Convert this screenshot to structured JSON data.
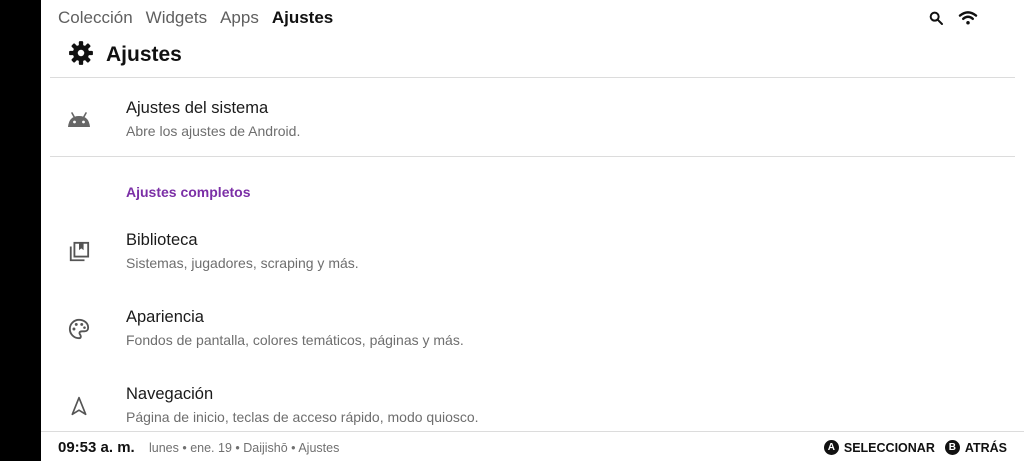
{
  "nav": {
    "tabs": [
      {
        "label": "Colección"
      },
      {
        "label": "Widgets"
      },
      {
        "label": "Apps"
      },
      {
        "label": "Ajustes"
      }
    ],
    "active_tab": "Ajustes",
    "icons": [
      "search-icon",
      "wifi-icon"
    ]
  },
  "page": {
    "icon": "gear-icon",
    "title": "Ajustes"
  },
  "system_item": {
    "icon": "android-icon",
    "title": "Ajustes del sistema",
    "subtitle": "Abre los ajustes de Android."
  },
  "section_label": "Ajustes completos",
  "items": [
    {
      "icon": "library-icon",
      "title": "Biblioteca",
      "subtitle": "Sistemas, jugadores, scraping y más."
    },
    {
      "icon": "palette-icon",
      "title": "Apariencia",
      "subtitle": "Fondos de pantalla, colores temáticos, páginas y más."
    },
    {
      "icon": "navigation-icon",
      "title": "Navegación",
      "subtitle": "Página de inicio, teclas de acceso rápido, modo quiosco."
    }
  ],
  "footer": {
    "time": "09:53 a. m.",
    "info": "lunes • ene. 19 • Daijishō • Ajustes",
    "hints": [
      {
        "button": "A",
        "label": "SELECCIONAR"
      },
      {
        "button": "B",
        "label": "ATRÁS"
      }
    ]
  },
  "colors": {
    "accent": "#7b2fa6",
    "text_primary": "#1a1a1a",
    "text_secondary": "#6e6e6e",
    "divider": "#dcdcdc"
  }
}
